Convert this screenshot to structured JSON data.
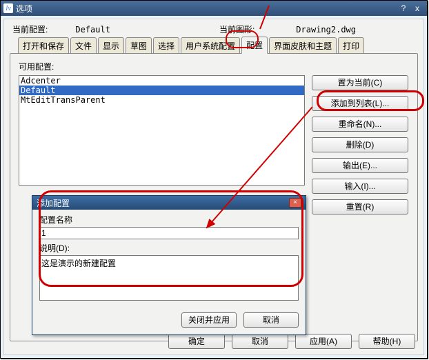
{
  "titlebar": {
    "title": "选项",
    "help": "?",
    "close": "x"
  },
  "top": {
    "curProfileLabel": "当前配置:",
    "curProfileValue": "Default",
    "curDrawingLabel": "当前图形:",
    "curDrawingValue": "Drawing2.dwg"
  },
  "tabs": [
    {
      "label": "打开和保存"
    },
    {
      "label": "文件"
    },
    {
      "label": "显示"
    },
    {
      "label": "草图"
    },
    {
      "label": "选择"
    },
    {
      "label": "用户系统配置"
    },
    {
      "label": "配置",
      "active": true
    },
    {
      "label": "界面皮肤和主题"
    },
    {
      "label": "打印"
    }
  ],
  "panel": {
    "availableLabel": "可用配置:",
    "items": [
      {
        "label": "Adcenter",
        "selected": false
      },
      {
        "label": "Default",
        "selected": true
      },
      {
        "label": "MtEditTransParent",
        "selected": false
      }
    ],
    "buttons": {
      "setCurrent": "置为当前(C)",
      "addToList": "添加到列表(L)...",
      "rename": "重命名(N)...",
      "delete": "删除(D)",
      "export": "输出(E)...",
      "import": "输入(I)...",
      "reset": "重置(R)"
    }
  },
  "footer": {
    "ok": "确定",
    "cancel": "取消",
    "apply": "应用(A)",
    "help": "帮助(H)"
  },
  "modal": {
    "title": "添加配置",
    "nameLabel": "配置名称",
    "nameValue": "1",
    "descLabel": "说明(D):",
    "descValue": "这是演示的新建配置",
    "close": "×",
    "applyClose": "关闭并应用",
    "cancel": "取消"
  }
}
